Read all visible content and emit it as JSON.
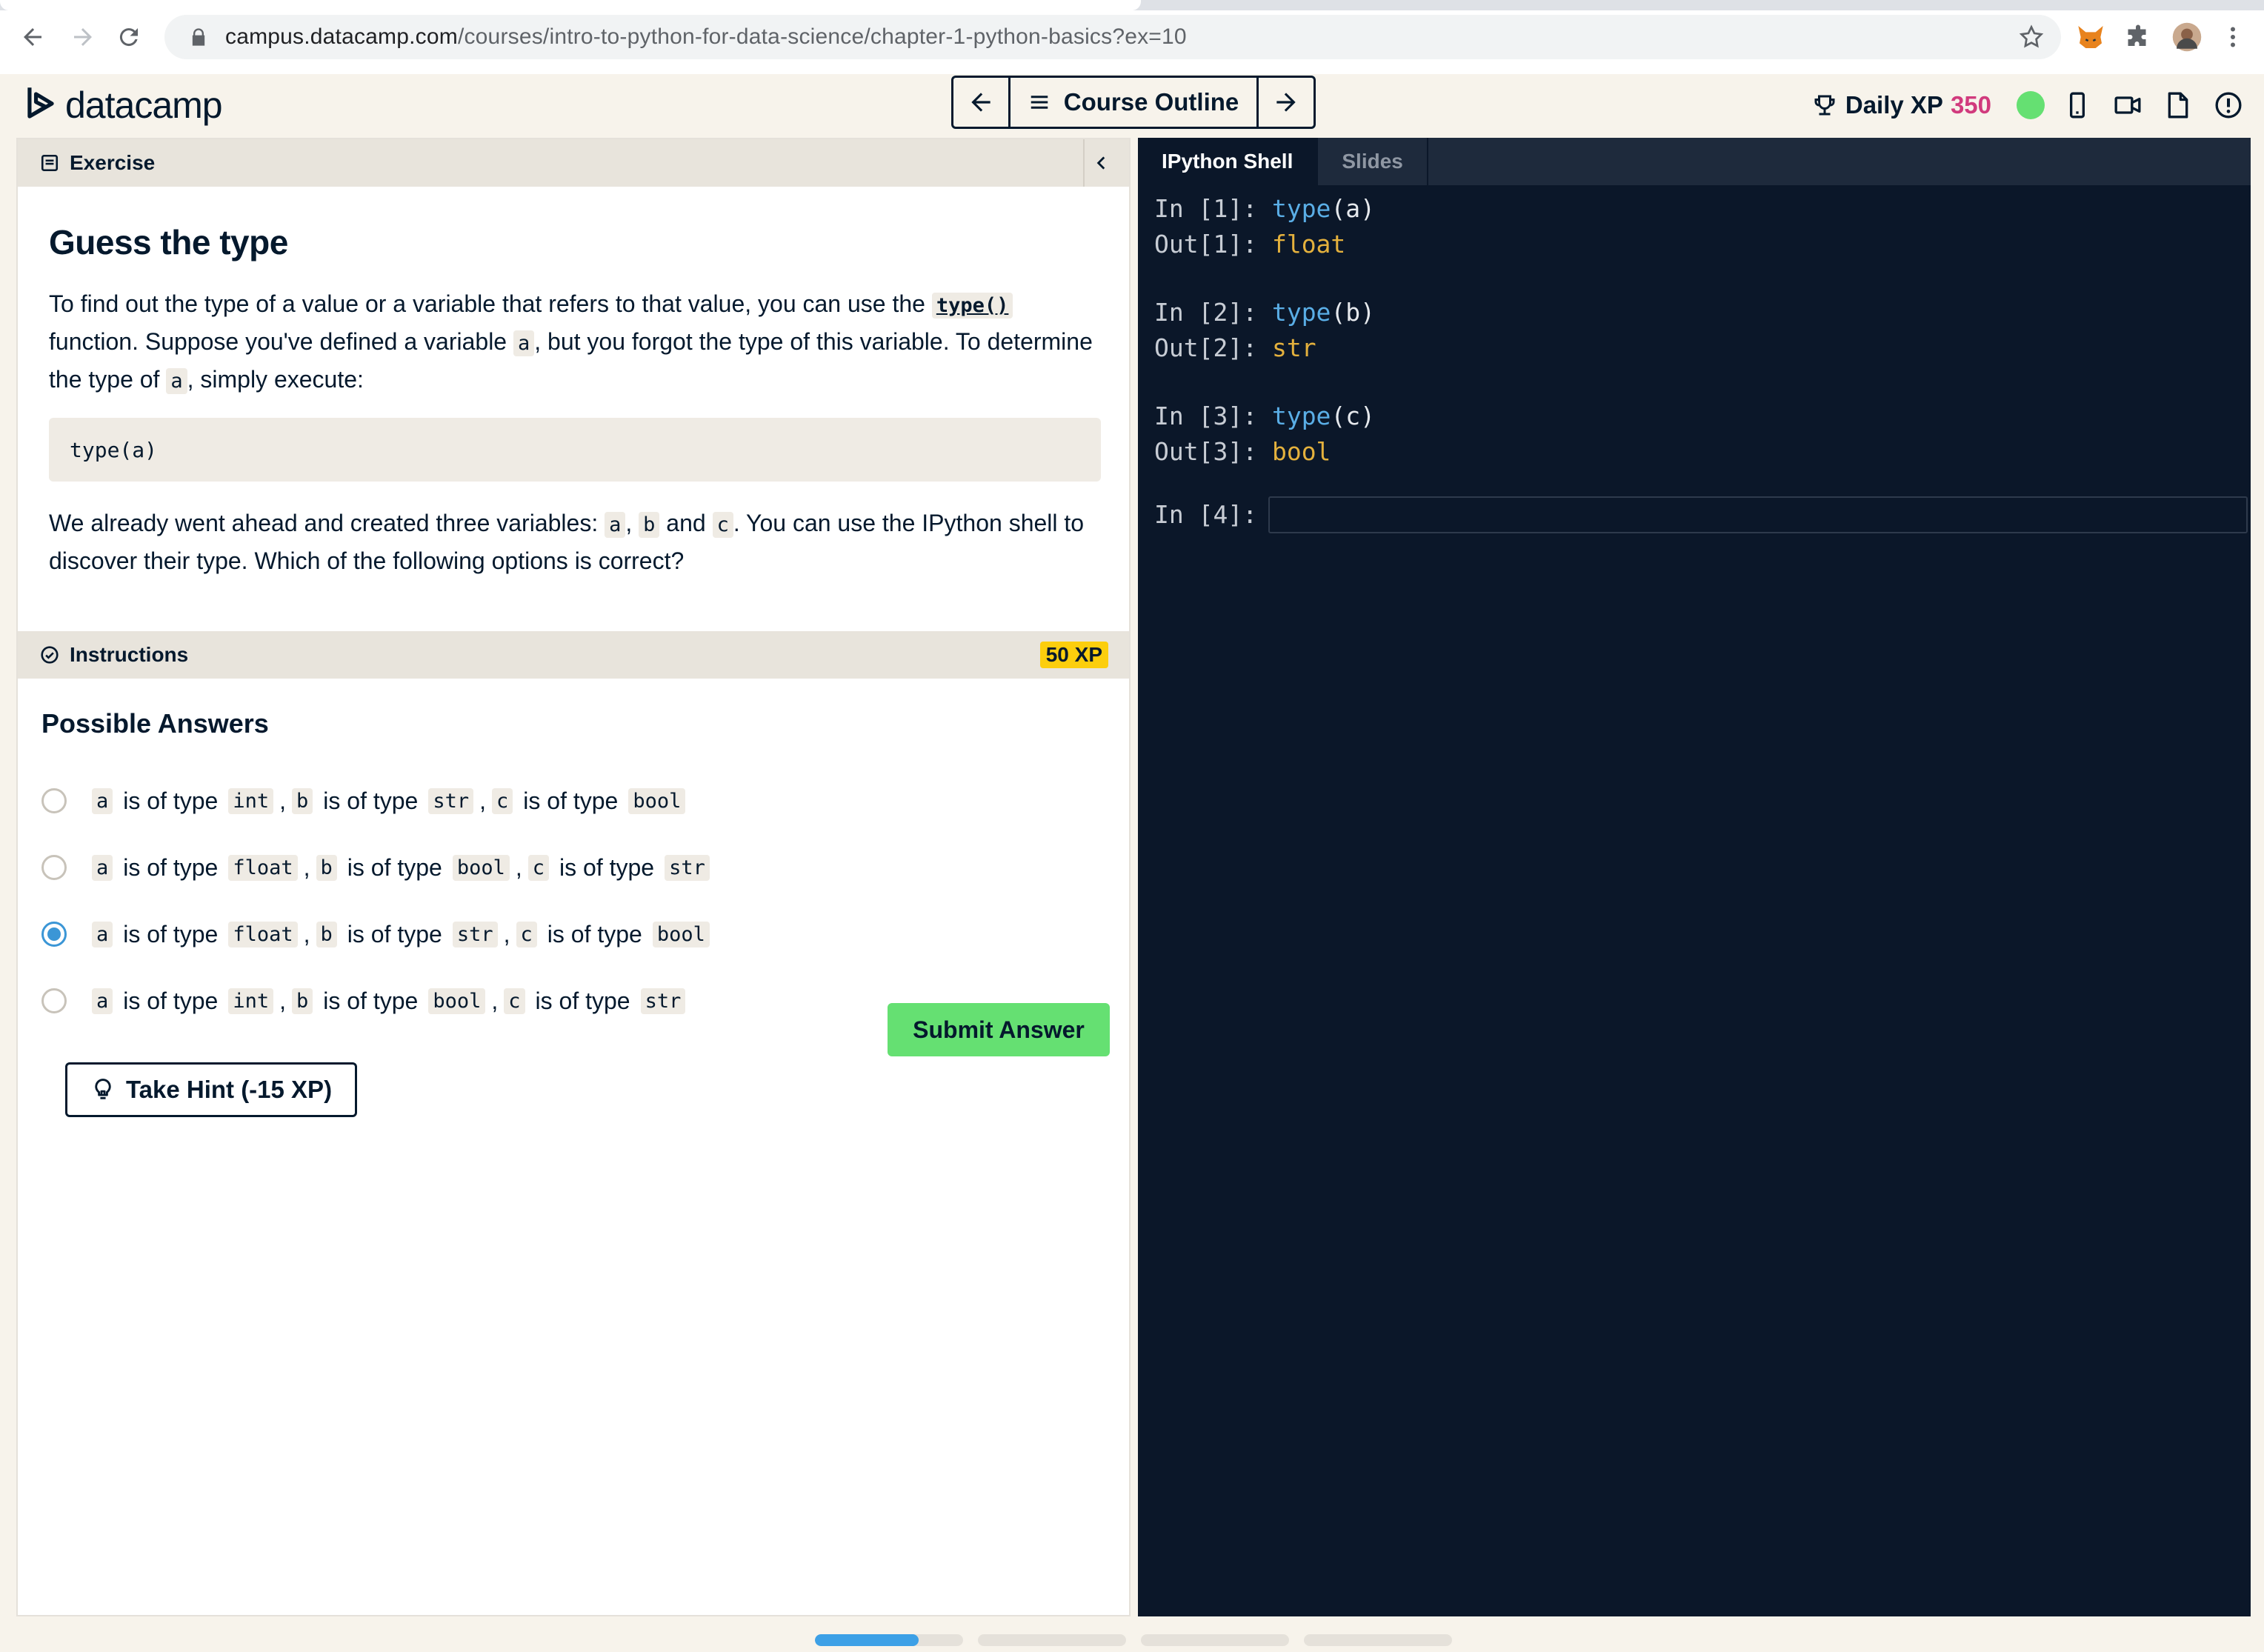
{
  "browser": {
    "url_host": "campus.datacamp.com",
    "url_path": "/courses/intro-to-python-for-data-science/chapter-1-python-basics?ex=10"
  },
  "header": {
    "logo_text": "datacamp",
    "course_outline_label": "Course Outline",
    "daily_xp_label": "Daily XP",
    "daily_xp_value": "350"
  },
  "exercise": {
    "section_label": "Exercise",
    "title": "Guess the type",
    "p1": {
      "t1": "To find out the type of a value or a variable that refers to that value, you can use the ",
      "c1": "type()",
      "t2": " function. Suppose you've defined a variable ",
      "c2": "a",
      "t3": ", but you forgot the type of this variable. To determine the type of ",
      "c3": "a",
      "t4": ", simply execute:"
    },
    "code_block": "type(a)",
    "p2": {
      "t1": "We already went ahead and created three variables: ",
      "c1": "a",
      "t2": ", ",
      "c2": "b",
      "t3": " and ",
      "c3": "c",
      "t4": ". You can use the IPython shell to discover their type. Which of the following options is correct?"
    }
  },
  "instructions": {
    "section_label": "Instructions",
    "xp_badge": "50 XP",
    "answers_title": "Possible Answers",
    "connector": "is of type",
    "comma": ",",
    "answers": [
      {
        "v1": "a",
        "t1": "int",
        "v2": "b",
        "t2": "str",
        "v3": "c",
        "t3": "bool",
        "selected": false
      },
      {
        "v1": "a",
        "t1": "float",
        "v2": "b",
        "t2": "bool",
        "v3": "c",
        "t3": "str",
        "selected": false
      },
      {
        "v1": "a",
        "t1": "float",
        "v2": "b",
        "t2": "str",
        "v3": "c",
        "t3": "bool",
        "selected": true
      },
      {
        "v1": "a",
        "t1": "int",
        "v2": "b",
        "t2": "bool",
        "v3": "c",
        "t3": "str",
        "selected": false
      }
    ],
    "submit_label": "Submit Answer",
    "hint_label": "Take Hint (-15 XP)"
  },
  "shell": {
    "tabs": [
      "IPython Shell",
      "Slides"
    ],
    "active_tab": "IPython Shell",
    "history": [
      {
        "in_prompt": "In [1]: ",
        "fn": "type",
        "arg": "(a)",
        "out_prompt": "Out[1]: ",
        "out": "float"
      },
      {
        "in_prompt": "In [2]: ",
        "fn": "type",
        "arg": "(b)",
        "out_prompt": "Out[2]: ",
        "out": "str"
      },
      {
        "in_prompt": "In [3]: ",
        "fn": "type",
        "arg": "(c)",
        "out_prompt": "Out[3]: ",
        "out": "bool"
      }
    ],
    "current_prompt": "In [4]:"
  },
  "progress": {
    "segments": 4,
    "current_fraction": 0.7
  },
  "colors": {
    "accent_green": "#65e072",
    "xp_pink": "#d13a7d",
    "xp_badge_yellow": "#fcce0d",
    "shell_bg": "#0b1729",
    "radio_selected": "#3b96d6"
  }
}
